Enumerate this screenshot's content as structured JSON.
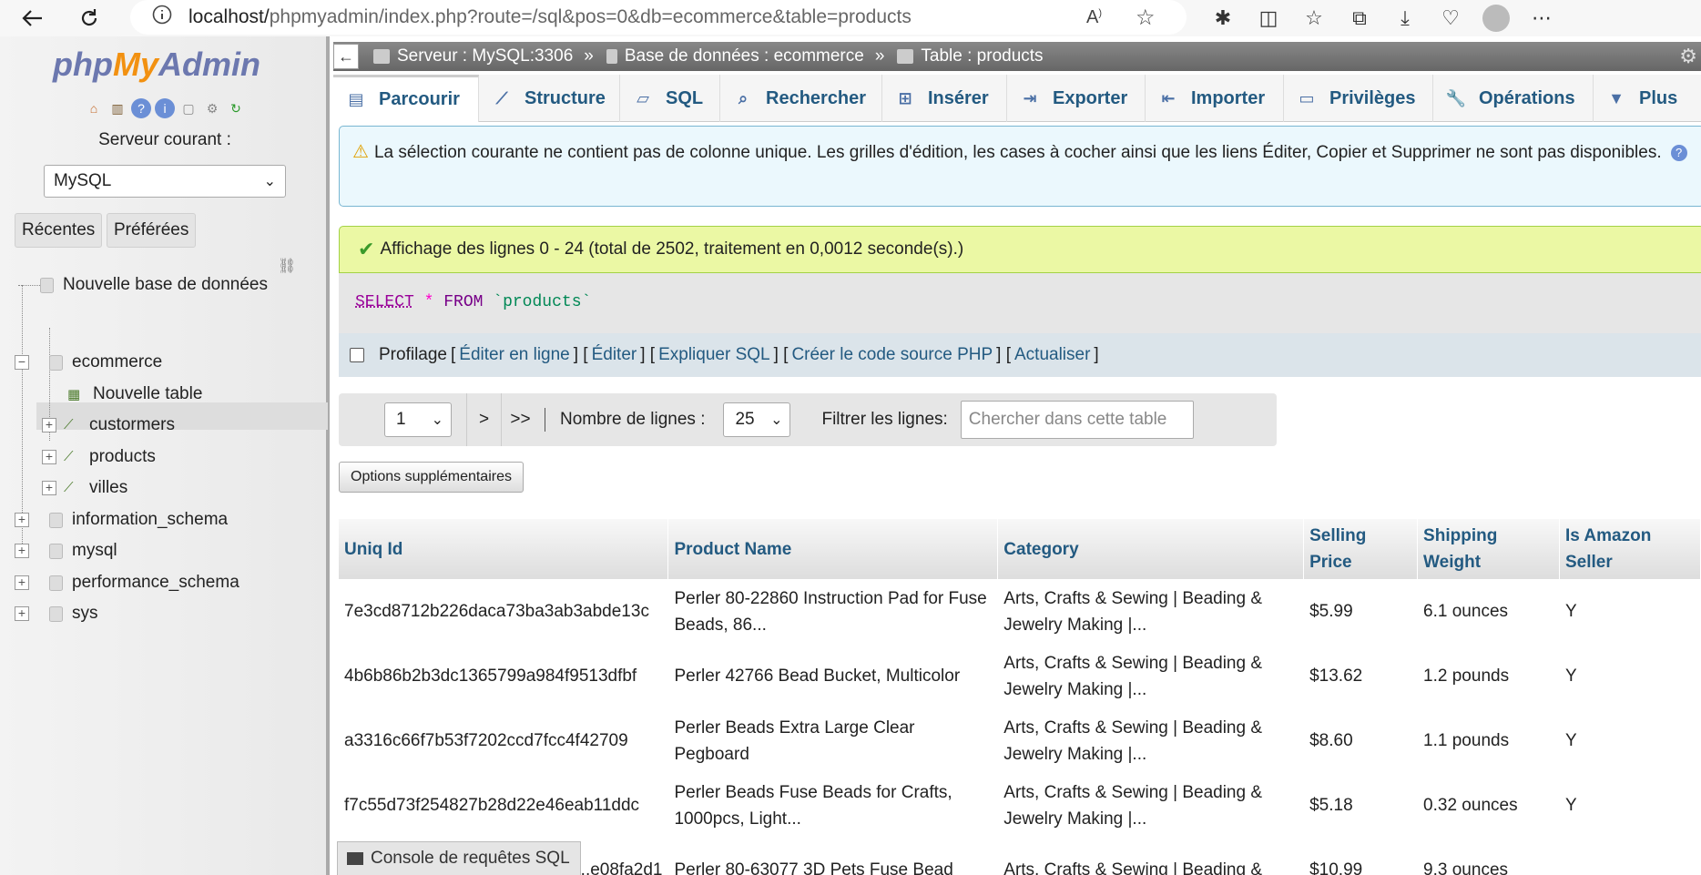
{
  "browser": {
    "url_host": "localhost/",
    "url_path": "phpmyadmin/index.php?route=/sql&pos=0&db=ecommerce&table=products"
  },
  "sidebar": {
    "logo_php": "php",
    "logo_my": "My",
    "logo_admin": "Admin",
    "server_label": "Serveur courant :",
    "server_value": "MySQL",
    "recent_tab": "Récentes",
    "favorites_tab": "Préférées",
    "tree": {
      "new_db": "Nouvelle base de données",
      "ecommerce": "ecommerce",
      "new_table": "Nouvelle table",
      "customers": "custormers",
      "products": "products",
      "villes": "villes",
      "information_schema": "information_schema",
      "mysql": "mysql",
      "performance_schema": "performance_schema",
      "sys": "sys"
    }
  },
  "breadcrumb": {
    "server": "Serveur : MySQL:3306",
    "database": "Base de données : ecommerce",
    "table": "Table : products",
    "separator": "»"
  },
  "tabs": [
    {
      "label": "Parcourir",
      "icon": "browse-icon"
    },
    {
      "label": "Structure",
      "icon": "structure-icon"
    },
    {
      "label": "SQL",
      "icon": "sql-icon"
    },
    {
      "label": "Rechercher",
      "icon": "search-icon"
    },
    {
      "label": "Insérer",
      "icon": "insert-icon"
    },
    {
      "label": "Exporter",
      "icon": "export-icon"
    },
    {
      "label": "Importer",
      "icon": "import-icon"
    },
    {
      "label": "Privilèges",
      "icon": "privileges-icon"
    },
    {
      "label": "Opérations",
      "icon": "operations-icon"
    },
    {
      "label": "Plus",
      "icon": "more-icon"
    }
  ],
  "notice": {
    "text": "La sélection courante ne contient pas de colonne unique. Les grilles d'édition, les cases à cocher ainsi que les liens Éditer, Copier et Supprimer ne sont pas disponibles."
  },
  "success": {
    "text": "Affichage des lignes 0 - 24 (total de 2502, traitement en 0,0012 seconde(s).)"
  },
  "sql": {
    "select": "SELECT",
    "star": "*",
    "from": "FROM",
    "table": "`products`"
  },
  "tools": {
    "profiling": "Profilage",
    "edit_inline": "Éditer en ligne",
    "edit": "Éditer",
    "explain": "Expliquer SQL",
    "php_code": "Créer le code source PHP",
    "refresh": "Actualiser"
  },
  "navigation": {
    "page": "1",
    "next": ">",
    "last": ">>",
    "rows_label": "Nombre de lignes :",
    "rows_value": "25",
    "filter_label": "Filtrer les lignes:",
    "filter_placeholder": "Chercher dans cette table"
  },
  "options_button": "Options supplémentaires",
  "table": {
    "headers": [
      "Uniq Id",
      "Product Name",
      "Category",
      "Selling Price",
      "Shipping Weight",
      "Is Amazon Seller"
    ],
    "rows": [
      [
        "7e3cd8712b226daca73ba3ab3abde13c",
        "Perler 80-22860 Instruction Pad for Fuse Beads, 86...",
        "Arts, Crafts & Sewing | Beading & Jewelry Making |...",
        "$5.99",
        "6.1 ounces",
        "Y"
      ],
      [
        "4b6b86b2b3dc1365799a984f9513dfbf",
        "Perler 42766 Bead Bucket, Multicolor",
        "Arts, Crafts & Sewing | Beading & Jewelry Making |...",
        "$13.62",
        "1.2 pounds",
        "Y"
      ],
      [
        "a3316c66f7b53f7202ccd7fcc4f42709",
        "Perler Beads Extra Large Clear Pegboard",
        "Arts, Crafts & Sewing | Beading & Jewelry Making |...",
        "$8.60",
        "1.1 pounds",
        "Y"
      ],
      [
        "f7c55d73f254827b28d22e46eab11ddc",
        "Perler Beads Fuse Beads for Crafts, 1000pcs, Light...",
        "Arts, Crafts & Sewing | Beading & Jewelry Making |...",
        "$5.18",
        "0.32 ounces",
        "Y"
      ],
      [
        "...e08fa2d1",
        "Perler 80-63077 3D Pets Fuse Bead",
        "Arts, Crafts & Sewing | Beading &",
        "$10.99",
        "9.3 ounces",
        ""
      ]
    ]
  },
  "console": {
    "label": "Console de requêtes SQL"
  }
}
